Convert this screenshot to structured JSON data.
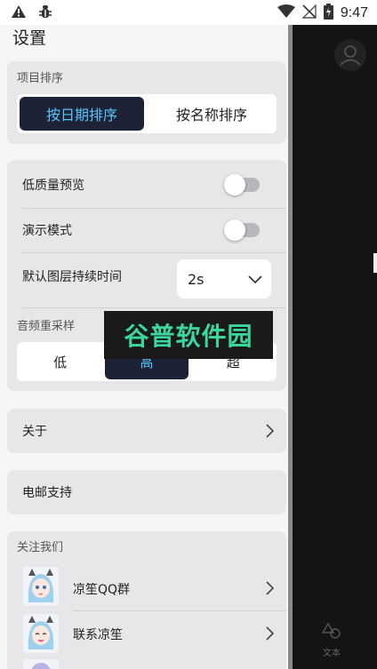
{
  "status_bar": {
    "time": "9:47",
    "left_icons": [
      "warning-icon",
      "bug-icon"
    ],
    "right_icons": [
      "wifi-icon",
      "no-signal-icon",
      "battery-charging-icon"
    ]
  },
  "drawer": {
    "title": "设置",
    "sort": {
      "label": "项目排序",
      "options": [
        "按日期排序",
        "按名称排序"
      ],
      "selected": 0
    },
    "settings": {
      "low_quality_preview": {
        "label": "低质量预览",
        "on": false
      },
      "demo_mode": {
        "label": "演示模式",
        "on": false
      },
      "default_layer_duration": {
        "label": "默认图层持续时间",
        "value": "2s"
      },
      "audio_resample": {
        "label": "音频重采样",
        "options": [
          "低",
          "高",
          "超"
        ],
        "selected": 1
      }
    },
    "about": {
      "label": "关于"
    },
    "email_support": {
      "label": "电邮支持"
    },
    "follow_us": {
      "label": "关注我们",
      "items": [
        {
          "label": "凉笙QQ群"
        },
        {
          "label": "联系凉笙"
        }
      ]
    }
  },
  "right_pane": {
    "bottom_tab_label": "文本"
  },
  "watermark": {
    "text": "谷普软件园"
  },
  "colors": {
    "accent": "#58c3ff",
    "active_segment_bg": "#1d2235",
    "card_bg": "#e7e7ea",
    "drawer_bg": "#f6f6f8",
    "dark_bg": "#141414",
    "watermark_text": "#3bd59f"
  }
}
